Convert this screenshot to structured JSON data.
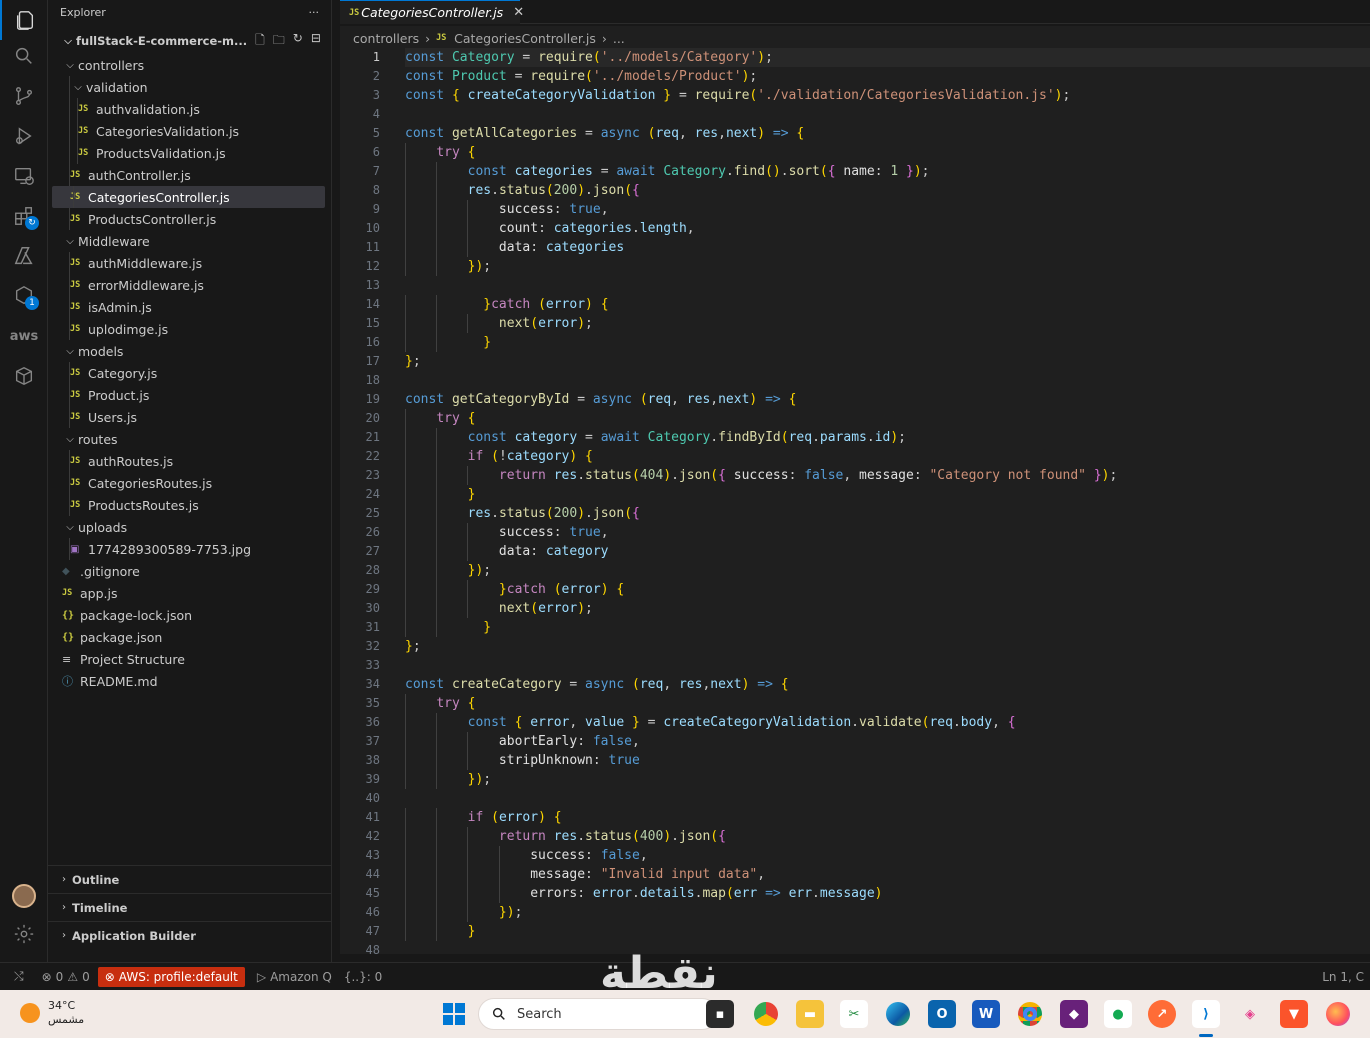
{
  "explorer": {
    "title": "Explorer",
    "more": "···",
    "root": "fullStack-E-commerce-m...",
    "items": [
      {
        "type": "folder",
        "label": "controllers",
        "depth": 1
      },
      {
        "type": "folder",
        "label": "validation",
        "depth": 2
      },
      {
        "type": "js",
        "label": "authvalidation.js",
        "depth": 3
      },
      {
        "type": "js",
        "label": "CategoriesValidation.js",
        "depth": 3
      },
      {
        "type": "js",
        "label": "ProductsValidation.js",
        "depth": 3
      },
      {
        "type": "js",
        "label": "authController.js",
        "depth": 2
      },
      {
        "type": "js",
        "label": "CategoriesController.js",
        "depth": 2,
        "selected": true
      },
      {
        "type": "js",
        "label": "ProductsController.js",
        "depth": 2
      },
      {
        "type": "folder",
        "label": "Middleware",
        "depth": 1
      },
      {
        "type": "js",
        "label": "authMiddleware.js",
        "depth": 2
      },
      {
        "type": "js",
        "label": "errorMiddleware.js",
        "depth": 2
      },
      {
        "type": "js",
        "label": "isAdmin.js",
        "depth": 2
      },
      {
        "type": "js",
        "label": "uplodimge.js",
        "depth": 2
      },
      {
        "type": "folder",
        "label": "models",
        "depth": 1
      },
      {
        "type": "js",
        "label": "Category.js",
        "depth": 2
      },
      {
        "type": "js",
        "label": "Product.js",
        "depth": 2
      },
      {
        "type": "js",
        "label": "Users.js",
        "depth": 2
      },
      {
        "type": "folder",
        "label": "routes",
        "depth": 1
      },
      {
        "type": "js",
        "label": "authRoutes.js",
        "depth": 2
      },
      {
        "type": "js",
        "label": "CategoriesRoutes.js",
        "depth": 2
      },
      {
        "type": "js",
        "label": "ProductsRoutes.js",
        "depth": 2
      },
      {
        "type": "folder",
        "label": "uploads",
        "depth": 1
      },
      {
        "type": "img",
        "label": "1774289300589-7753.jpg",
        "depth": 2
      },
      {
        "type": "git",
        "label": ".gitignore",
        "depth": 1
      },
      {
        "type": "js",
        "label": "app.js",
        "depth": 1
      },
      {
        "type": "json",
        "label": "package-lock.json",
        "depth": 1
      },
      {
        "type": "json",
        "label": "package.json",
        "depth": 1
      },
      {
        "type": "list",
        "label": "Project Structure",
        "depth": 1
      },
      {
        "type": "md",
        "label": "README.md",
        "depth": 1
      }
    ],
    "sections": [
      "Outline",
      "Timeline",
      "Application Builder"
    ]
  },
  "tab": {
    "label": "CategoriesController.js",
    "lang": "JS"
  },
  "breadcrumb": {
    "folder": "controllers",
    "file": "CategoriesController.js",
    "more": "..."
  },
  "code": {
    "current_line": 1,
    "lines": [
      "const Category = require('../models/Category');",
      "const Product = require('../models/Product');",
      "const { createCategoryValidation } = require('./validation/CategoriesValidation.js');",
      "",
      "const getAllCategories = async (req, res,next) => {",
      "    try {",
      "        const categories = await Category.find().sort({ name: 1 });",
      "        res.status(200).json({",
      "            success: true,",
      "            count: categories.length,",
      "            data: categories",
      "        });",
      "",
      "          }catch (error) {",
      "            next(error);",
      "          }",
      "};",
      "",
      "const getCategoryById = async (req, res,next) => {",
      "    try {",
      "        const category = await Category.findById(req.params.id);",
      "        if (!category) {",
      "            return res.status(404).json({ success: false, message: \"Category not found\" });",
      "        }",
      "        res.status(200).json({",
      "            success: true,",
      "            data: category",
      "        });",
      "            }catch (error) {",
      "            next(error);",
      "          }",
      "};",
      "",
      "const createCategory = async (req, res,next) => {",
      "    try {",
      "        const { error, value } = createCategoryValidation.validate(req.body, {",
      "            abortEarly: false,",
      "            stripUnknown: true",
      "        });",
      "",
      "        if (error) {",
      "            return res.status(400).json({",
      "                success: false,",
      "                message: \"Invalid input data\",",
      "                errors: error.details.map(err => err.message)",
      "            });",
      "        }",
      ""
    ]
  },
  "status": {
    "errors": "0",
    "warnings": "0",
    "aws": "AWS: profile:default",
    "amazonq": "Amazon Q",
    "braces": "{..}: 0",
    "position": "Ln 1, C"
  },
  "taskbar": {
    "temperature": "34°C",
    "weather": "مشمس",
    "search": "Search"
  },
  "watermark": "نقطة"
}
